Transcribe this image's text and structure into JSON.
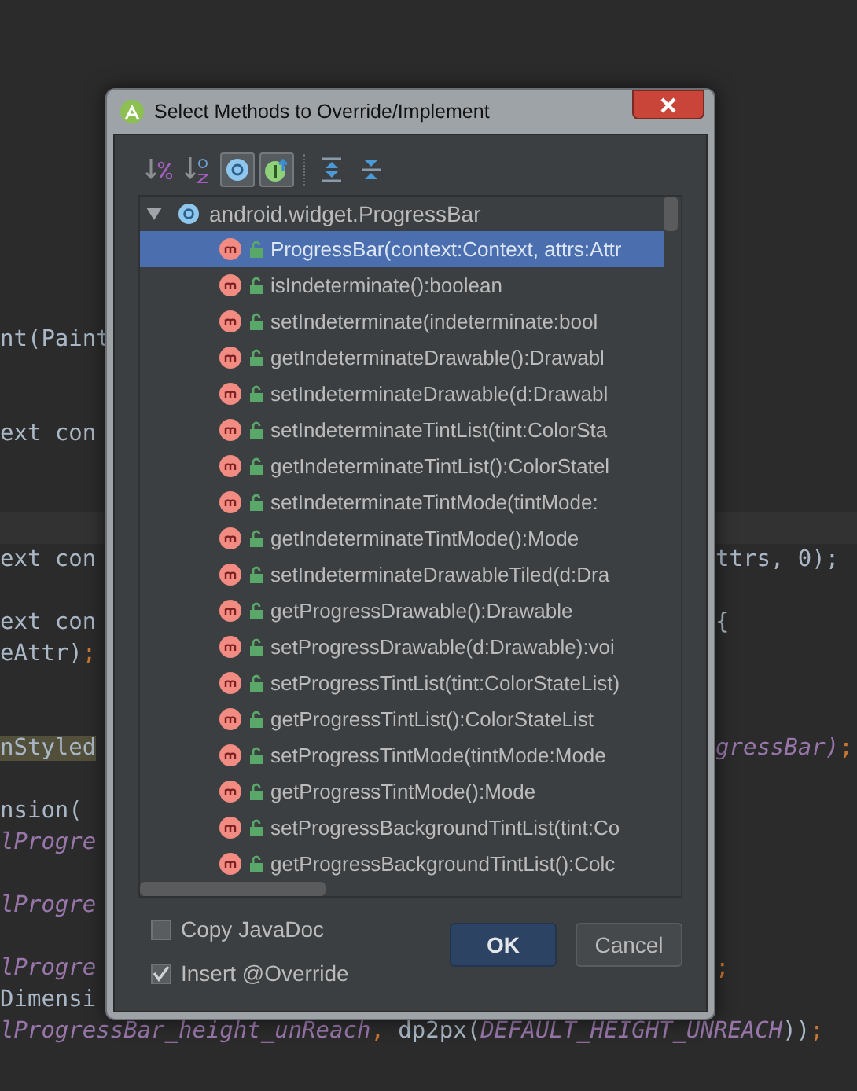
{
  "editor": {
    "lines": [
      {
        "kind": "code",
        "left": [
          {
            "text": "nt(Paint",
            "kind": "plain"
          }
        ]
      },
      {
        "kind": "blank"
      },
      {
        "kind": "blank"
      },
      {
        "kind": "code",
        "left": [
          {
            "text": "ext con",
            "kind": "plain"
          }
        ]
      },
      {
        "kind": "blank"
      },
      {
        "kind": "blank"
      },
      {
        "kind": "caret"
      },
      {
        "kind": "code",
        "left": [
          {
            "text": "ext con",
            "kind": "plain"
          }
        ],
        "right": [
          {
            "text": "ttrs, 0);",
            "kind": "plain"
          }
        ]
      },
      {
        "kind": "blank"
      },
      {
        "kind": "code",
        "left": [
          {
            "text": "ext con",
            "kind": "plain"
          }
        ],
        "right": [
          {
            "text": "{",
            "kind": "plain"
          }
        ]
      },
      {
        "kind": "code",
        "left": [
          {
            "text": "eAttr)",
            "kind": "plain"
          },
          {
            "text": ";",
            "kind": "keyword"
          }
        ]
      },
      {
        "kind": "blank"
      },
      {
        "kind": "blank"
      },
      {
        "kind": "code",
        "left": [
          {
            "text": "nStyled",
            "kind": "highlight"
          }
        ],
        "right": [
          {
            "text": "gressBar)",
            "kind": "field"
          },
          {
            "text": ";",
            "kind": "keyword"
          }
        ]
      },
      {
        "kind": "blank"
      },
      {
        "kind": "code",
        "left": [
          {
            "text": "nsion(",
            "kind": "plain"
          }
        ]
      },
      {
        "kind": "code",
        "left": [
          {
            "text": "lProgre",
            "kind": "field"
          }
        ]
      },
      {
        "kind": "blank"
      },
      {
        "kind": "code",
        "left": [
          {
            "text": "lProgre",
            "kind": "field"
          }
        ]
      },
      {
        "kind": "blank"
      },
      {
        "kind": "code",
        "left": [
          {
            "text": "lProgre",
            "kind": "field"
          }
        ],
        "right": [
          {
            "text": ";",
            "kind": "keyword"
          }
        ]
      },
      {
        "kind": "code",
        "left": [
          {
            "text": "Dimensi",
            "kind": "plain"
          }
        ]
      },
      {
        "kind": "full",
        "left": [
          {
            "text": "lProgressBar_height_unReach",
            "kind": "field"
          },
          {
            "text": ", ",
            "kind": "keyword"
          },
          {
            "text": "dp2px(",
            "kind": "plain"
          },
          {
            "text": "DEFAULT_HEIGHT_UNREACH",
            "kind": "field"
          },
          {
            "text": "))",
            "kind": "plain"
          },
          {
            "text": ";",
            "kind": "keyword"
          }
        ]
      }
    ]
  },
  "dialog": {
    "title": "Select Methods to Override/Implement",
    "toolbar": [
      {
        "kind": "sort-visibility",
        "selected": false
      },
      {
        "kind": "sort-alpha",
        "selected": false
      },
      {
        "kind": "show-classes",
        "selected": true
      },
      {
        "kind": "show-interfaces",
        "selected": true
      },
      {
        "kind": "separator"
      },
      {
        "kind": "expand-all",
        "selected": false
      },
      {
        "kind": "collapse-all",
        "selected": false
      }
    ],
    "tree": {
      "label": "android.widget.ProgressBar",
      "expanded": true,
      "children": [
        {
          "label": "ProgressBar(context:Context, attrs:Attr",
          "selected": true
        },
        {
          "label": "isIndeterminate():boolean",
          "selected": false
        },
        {
          "label": "setIndeterminate(indeterminate:bool",
          "selected": false
        },
        {
          "label": "getIndeterminateDrawable():Drawabl",
          "selected": false
        },
        {
          "label": "setIndeterminateDrawable(d:Drawabl",
          "selected": false
        },
        {
          "label": "setIndeterminateTintList(tint:ColorSta",
          "selected": false
        },
        {
          "label": "getIndeterminateTintList():ColorStatel",
          "selected": false
        },
        {
          "label": "setIndeterminateTintMode(tintMode:",
          "selected": false
        },
        {
          "label": "getIndeterminateTintMode():Mode",
          "selected": false
        },
        {
          "label": "setIndeterminateDrawableTiled(d:Dra",
          "selected": false
        },
        {
          "label": "getProgressDrawable():Drawable",
          "selected": false
        },
        {
          "label": "setProgressDrawable(d:Drawable):voi",
          "selected": false
        },
        {
          "label": "setProgressTintList(tint:ColorStateList)",
          "selected": false
        },
        {
          "label": "getProgressTintList():ColorStateList",
          "selected": false
        },
        {
          "label": "setProgressTintMode(tintMode:Mode",
          "selected": false
        },
        {
          "label": "getProgressTintMode():Mode",
          "selected": false
        },
        {
          "label": "setProgressBackgroundTintList(tint:Co",
          "selected": false
        },
        {
          "label": "getProgressBackgroundTintList():Colc",
          "selected": false
        }
      ]
    },
    "options": [
      {
        "label": "Copy JavaDoc",
        "checked": false
      },
      {
        "label": "Insert @Override",
        "checked": true
      }
    ],
    "buttons": [
      {
        "label": "OK",
        "kind": "default"
      },
      {
        "label": "Cancel",
        "kind": "normal"
      }
    ]
  }
}
